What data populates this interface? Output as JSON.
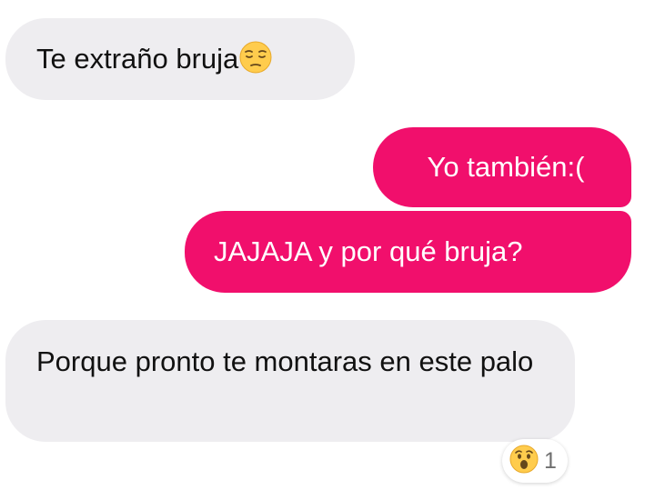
{
  "messages": [
    {
      "text": "Te extraño bruja",
      "emoji": "pensive-face-icon"
    },
    {
      "text": "Yo también:("
    },
    {
      "text": "JAJAJA y por qué bruja?"
    },
    {
      "text": "Porque pronto te montaras en este palo"
    }
  ],
  "reaction": {
    "emoji": "surprised-face-icon",
    "count": "1"
  },
  "colors": {
    "incoming_bubble": "#eeedf0",
    "outgoing_bubble": "#f10f6c",
    "background": "#ffffff"
  }
}
